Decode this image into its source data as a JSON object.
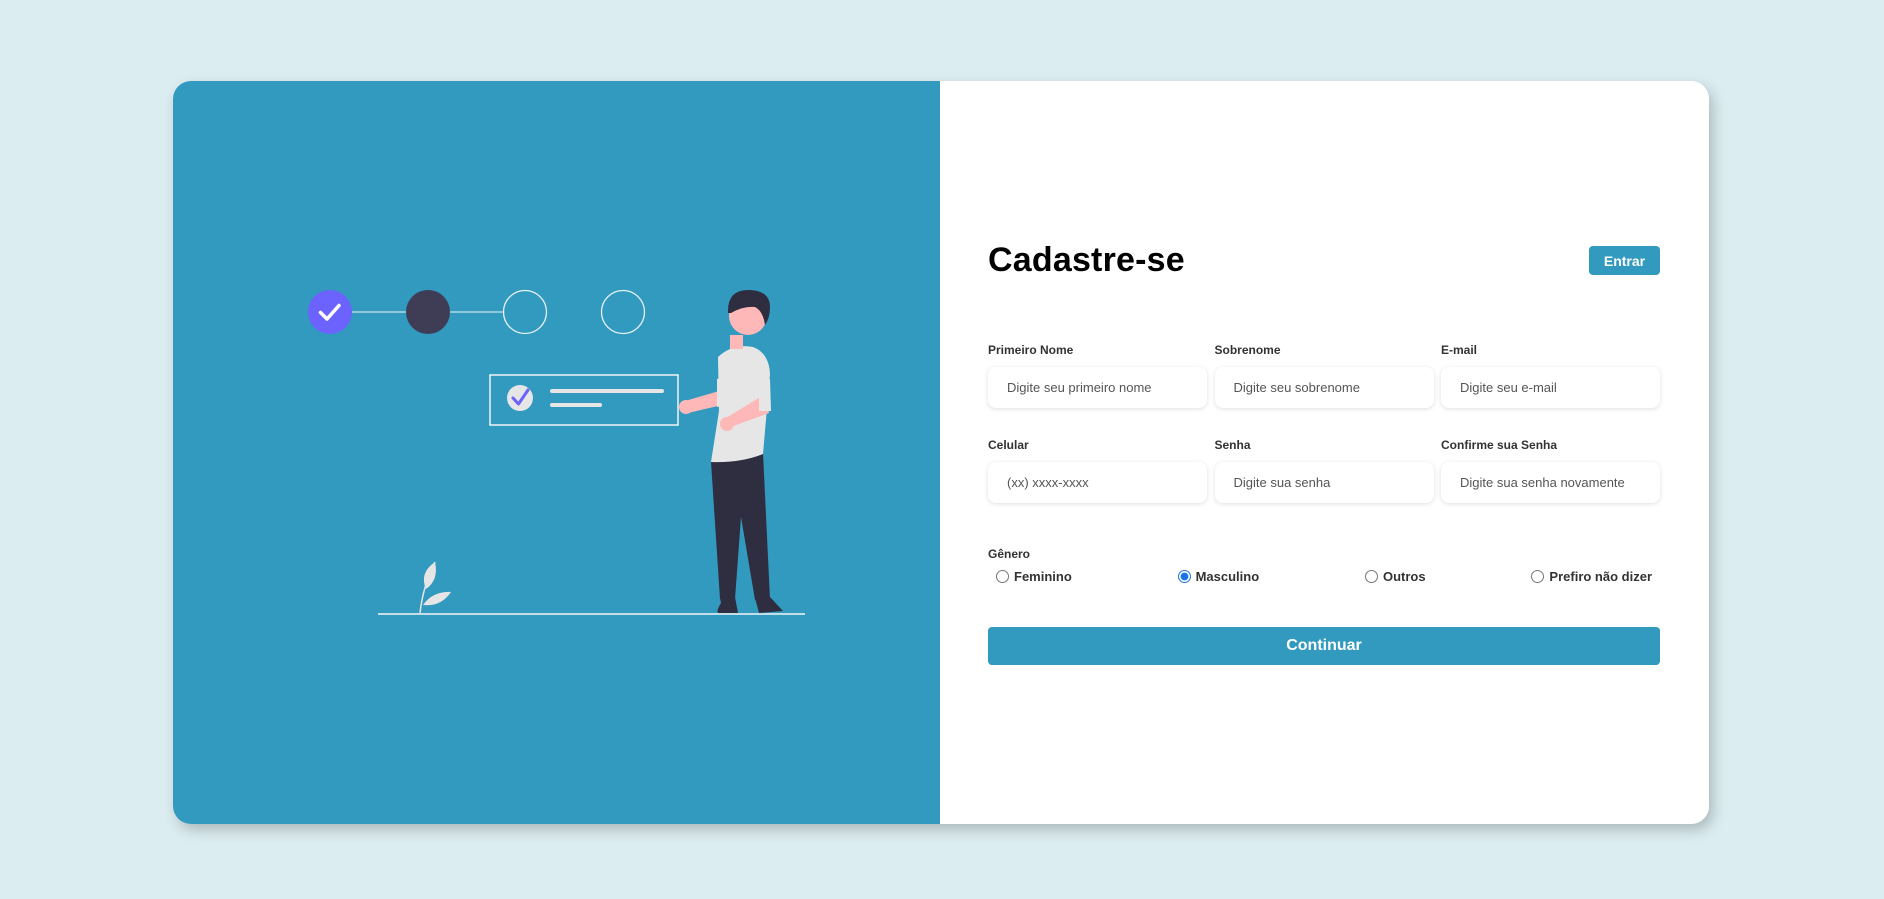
{
  "colors": {
    "page_background": "#dcedf1",
    "accent": "#3299bf",
    "step_done": "#6c63ff",
    "step_current": "#3f3d56"
  },
  "header": {
    "title": "Cadastre-se",
    "login_label": "Entrar"
  },
  "fields": [
    {
      "label": "Primeiro Nome",
      "placeholder": "Digite seu primeiro nome",
      "type": "text"
    },
    {
      "label": "Sobrenome",
      "placeholder": "Digite seu sobrenome",
      "type": "text"
    },
    {
      "label": "E-mail",
      "placeholder": "Digite seu e-mail",
      "type": "email"
    },
    {
      "label": "Celular",
      "placeholder": "(xx) xxxx-xxxx",
      "type": "tel"
    },
    {
      "label": "Senha",
      "placeholder": "Digite sua senha",
      "type": "password"
    },
    {
      "label": "Confirme sua Senha",
      "placeholder": "Digite sua senha novamente",
      "type": "password"
    }
  ],
  "gender": {
    "title": "Gênero",
    "options": [
      {
        "label": "Feminino",
        "checked": false
      },
      {
        "label": "Masculino",
        "checked": true
      },
      {
        "label": "Outros",
        "checked": false
      },
      {
        "label": "Prefiro não dizer",
        "checked": false
      }
    ]
  },
  "continue_label": "Continuar",
  "illustration": {
    "steps": [
      "done",
      "current",
      "pending",
      "pending"
    ],
    "icons": [
      "check-icon",
      "person-figure",
      "leaf-plant"
    ]
  }
}
